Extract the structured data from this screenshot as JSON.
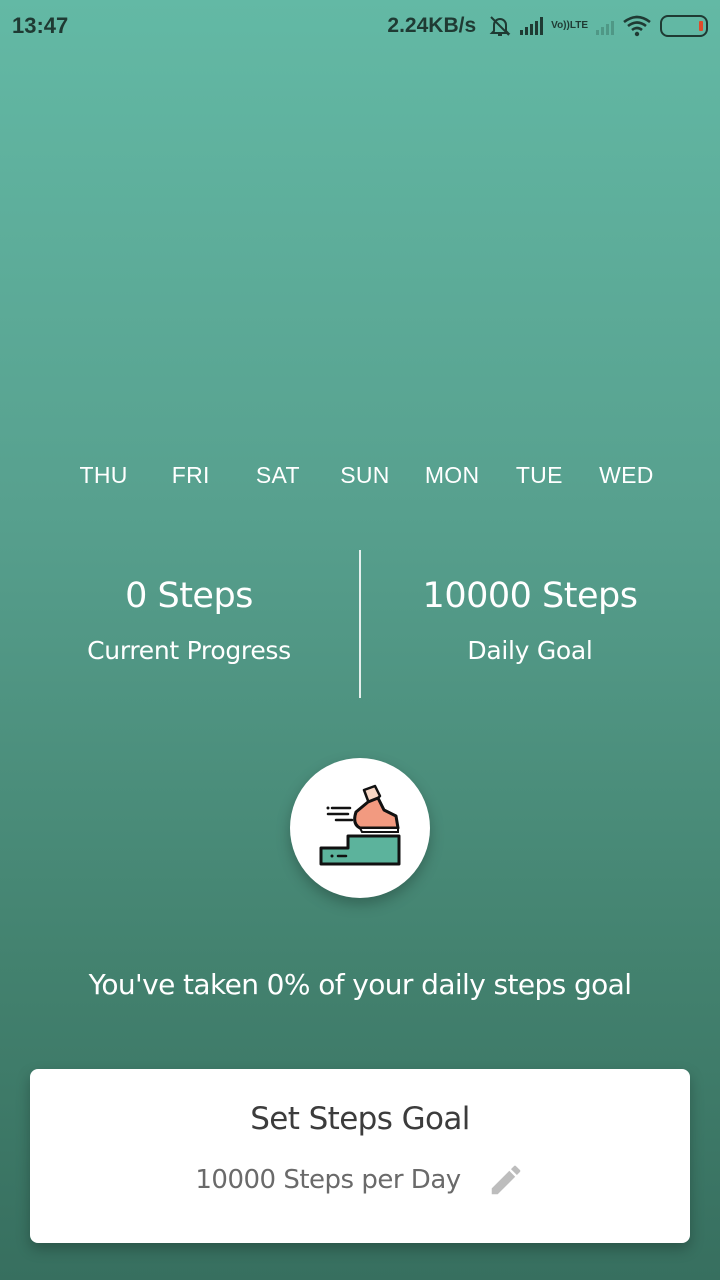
{
  "status_bar": {
    "time": "13:47",
    "net_speed": "2.24KB/s",
    "lte_label_top": "Vo))",
    "lte_label_bottom": "LTE"
  },
  "days": [
    "THU",
    "FRI",
    "SAT",
    "SUN",
    "MON",
    "TUE",
    "WED"
  ],
  "stats": {
    "current_value": "0 Steps",
    "current_label": "Current Progress",
    "goal_value": "10000 Steps",
    "goal_label": "Daily Goal"
  },
  "progress_message": "You've taken 0% of your daily steps goal",
  "goal_card": {
    "title": "Set Steps Goal",
    "subtitle": "10000 Steps per Day"
  },
  "icons": {
    "step_icon": "running-shoe-stairs-icon",
    "edit_icon": "pencil-icon"
  },
  "colors": {
    "gradient_top": "#63b9a5",
    "gradient_bottom": "#376f5f",
    "shoe": "#f29a80",
    "stair": "#5cb39c"
  }
}
